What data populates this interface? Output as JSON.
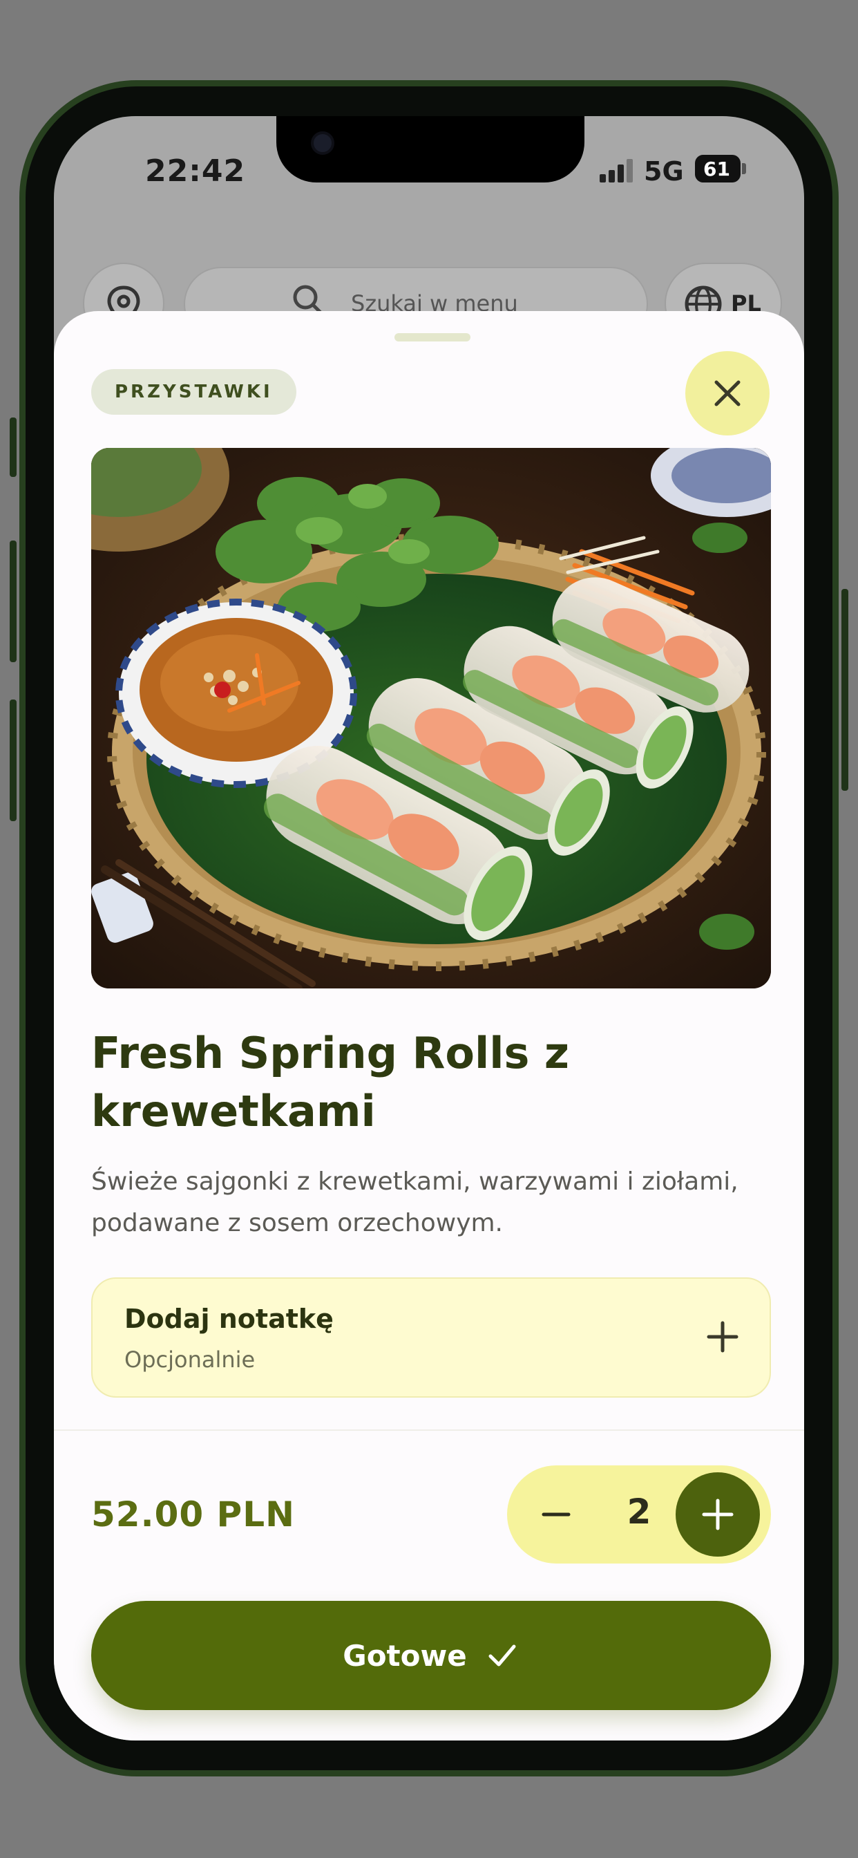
{
  "status_bar": {
    "time": "22:42",
    "network": "5G",
    "battery": "61"
  },
  "header": {
    "search_placeholder": "Szukaj w menu",
    "language": "PL"
  },
  "item": {
    "category": "PRZYSTAWKI",
    "title": "Fresh Spring Rolls z krewetkami",
    "description": "Świeże sajgonki z krewetkami, warzywami i ziołami, podawane z sosem orzechowym.",
    "price": "52.00 PLN",
    "quantity": "2"
  },
  "note": {
    "title": "Dodaj notatkę",
    "subtitle": "Opcjonalnie"
  },
  "actions": {
    "done_label": "Gotowe"
  },
  "icons": [
    "location-pin-icon",
    "search-icon",
    "globe-icon",
    "close-icon",
    "plus-icon",
    "minus-icon",
    "check-icon"
  ],
  "colors": {
    "accent": "#536b0a",
    "accent_light": "#f6f39c",
    "chip": "#e4e8d8",
    "note_bg": "#fefbd0",
    "title": "#2e3a10"
  }
}
